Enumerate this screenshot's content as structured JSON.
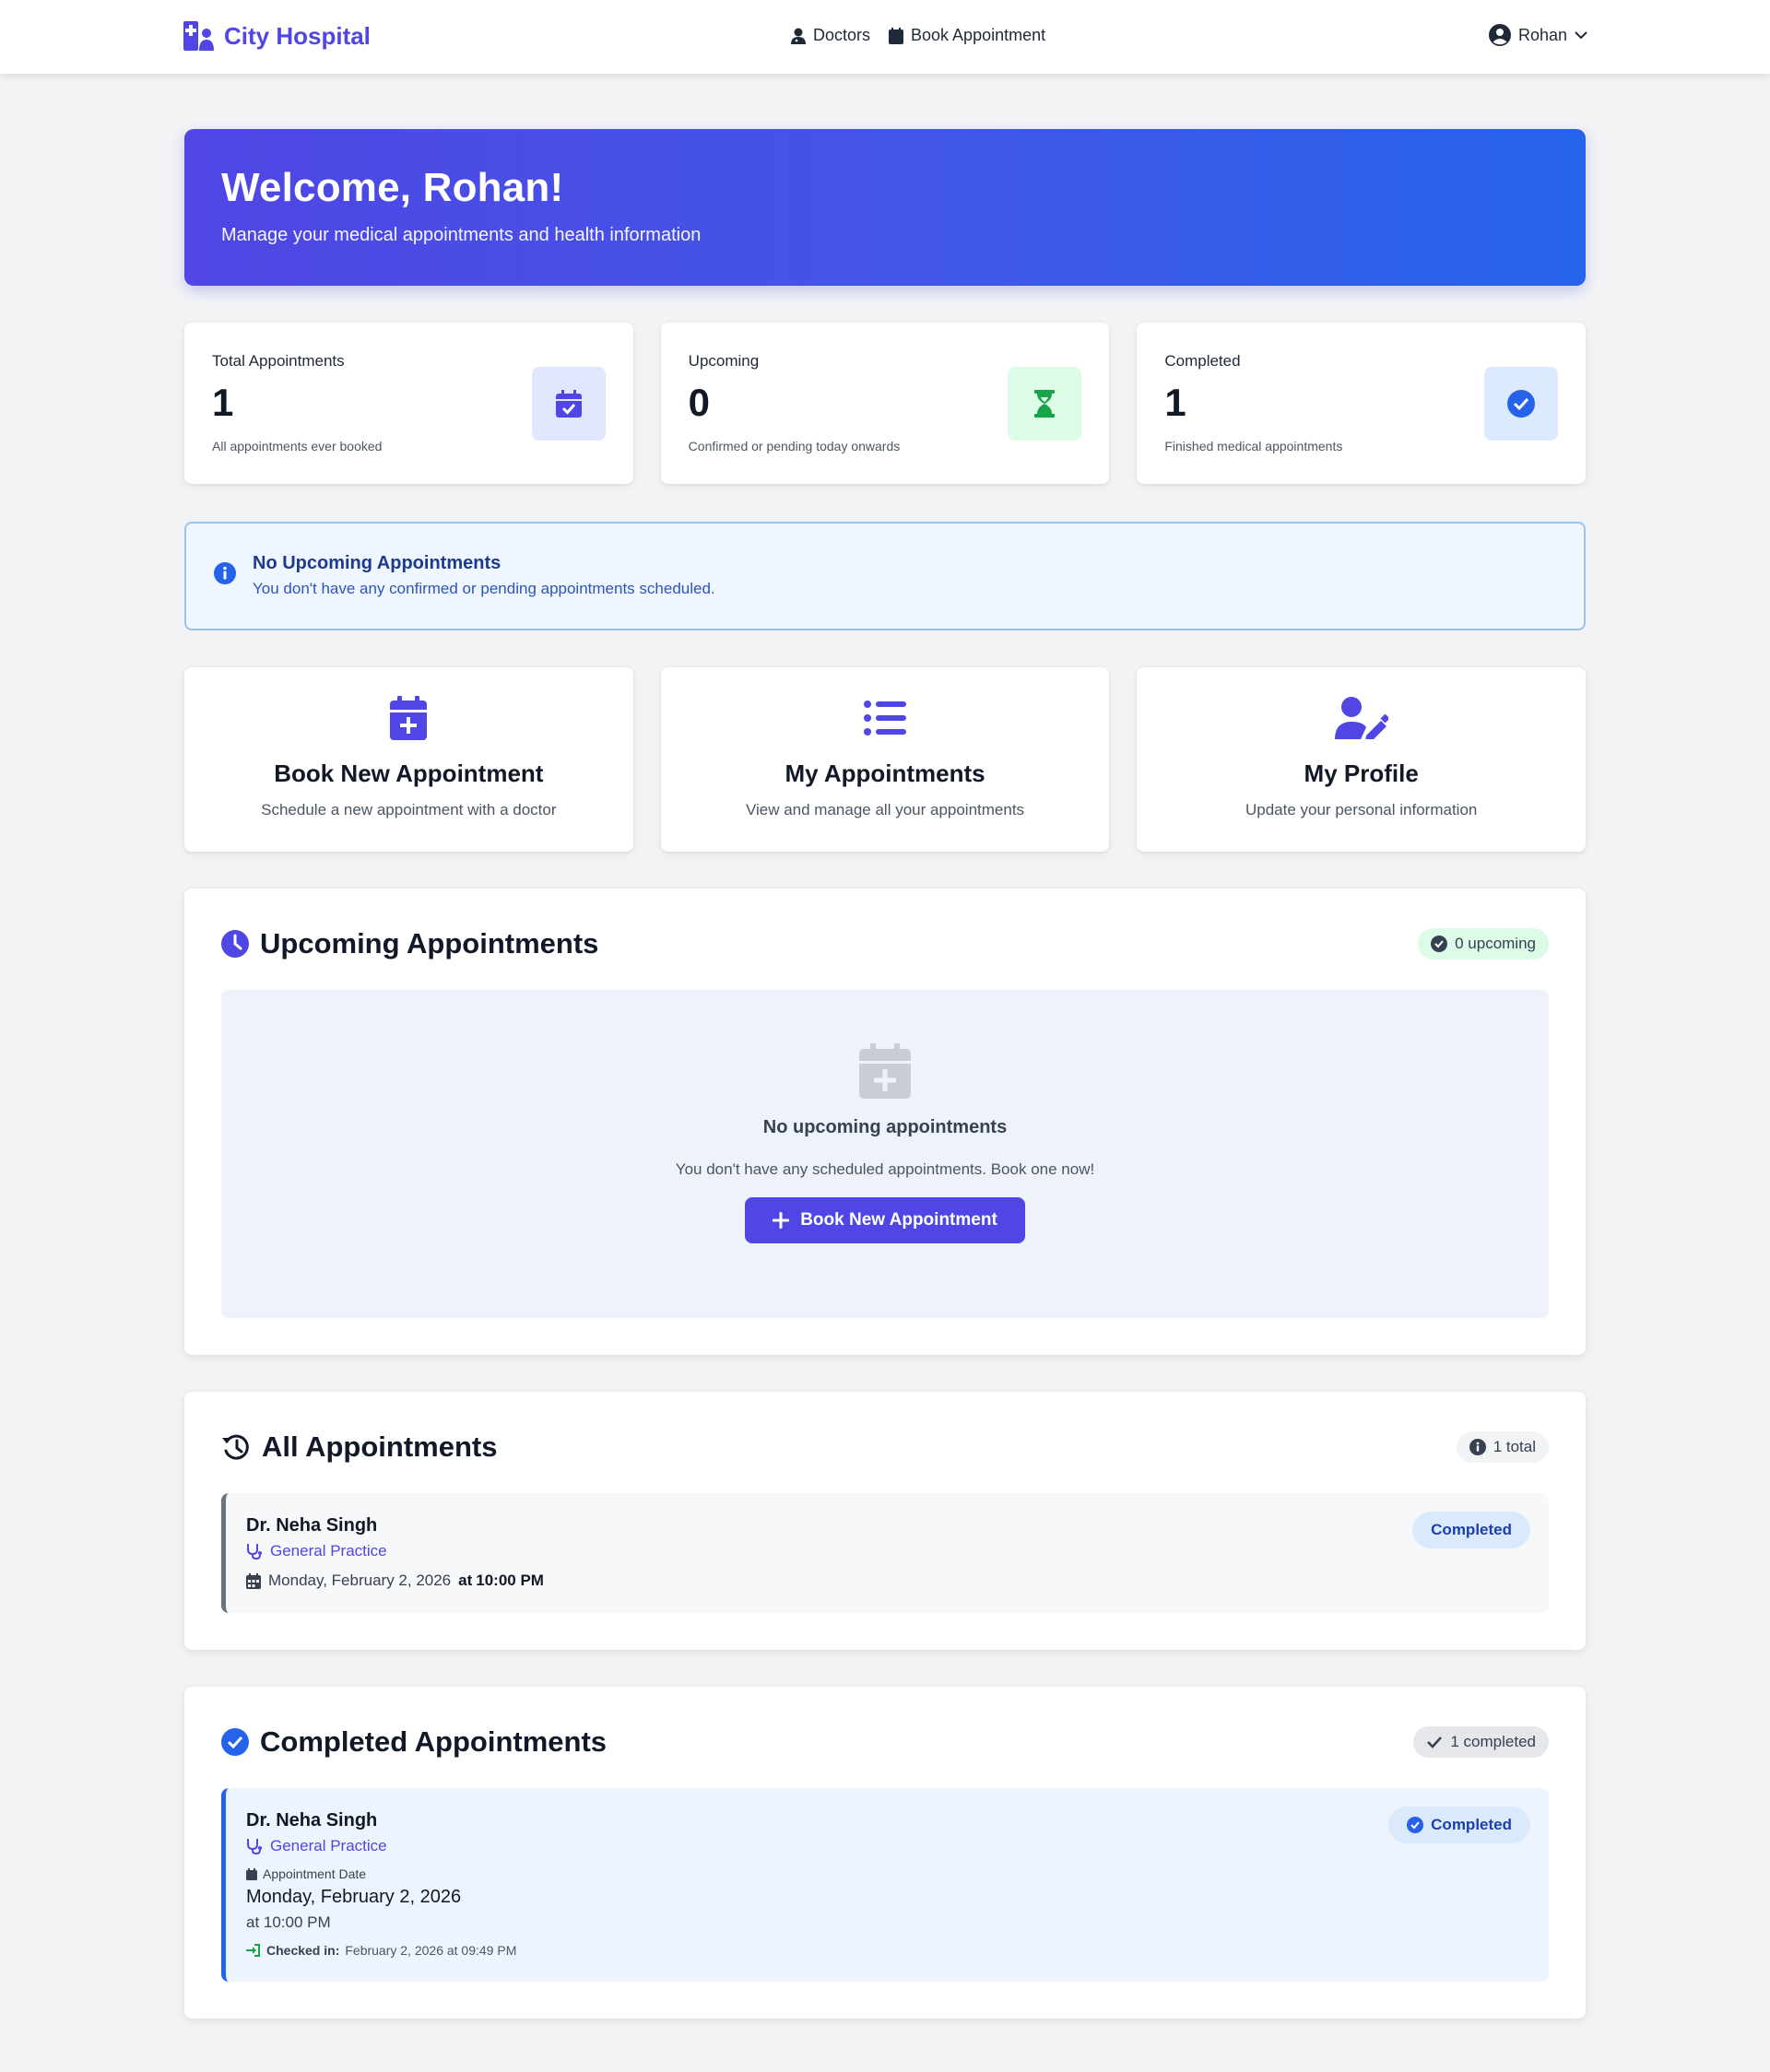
{
  "navbar": {
    "brand": "City Hospital",
    "links": [
      {
        "label": "Doctors",
        "icon": "user-md-icon"
      },
      {
        "label": "Book Appointment",
        "icon": "calendar-icon"
      }
    ],
    "user": "Rohan"
  },
  "hero": {
    "title": "Welcome, Rohan!",
    "subtitle": "Manage your medical appointments and health information"
  },
  "stats": [
    {
      "label": "Total Appointments",
      "value": "1",
      "desc": "All appointments ever booked",
      "icon": "calendar-check-icon",
      "color": "#4f46e5",
      "bg": "#e0e7ff"
    },
    {
      "label": "Upcoming",
      "value": "0",
      "desc": "Confirmed or pending today onwards",
      "icon": "hourglass-icon",
      "color": "#16a34a",
      "bg": "#dcfce7"
    },
    {
      "label": "Completed",
      "value": "1",
      "desc": "Finished medical appointments",
      "icon": "check-circle-icon",
      "color": "#2563eb",
      "bg": "#dbeafe"
    }
  ],
  "alert": {
    "title": "No Upcoming Appointments",
    "text": "You don't have any confirmed or pending appointments scheduled."
  },
  "actions": [
    {
      "title": "Book New Appointment",
      "desc": "Schedule a new appointment with a doctor",
      "icon": "calendar-plus-icon"
    },
    {
      "title": "My Appointments",
      "desc": "View and manage all your appointments",
      "icon": "list-icon"
    },
    {
      "title": "My Profile",
      "desc": "Update your personal information",
      "icon": "user-edit-icon"
    }
  ],
  "upcoming": {
    "title": "Upcoming Appointments",
    "badge": "0 upcoming",
    "empty_title": "No upcoming appointments",
    "empty_text": "You don't have any scheduled appointments. Book one now!",
    "button": "Book New Appointment"
  },
  "all": {
    "title": "All Appointments",
    "badge": "1 total",
    "items": [
      {
        "doctor": "Dr. Neha Singh",
        "specialty": "General Practice",
        "date": "Monday, February 2, 2026",
        "at": "at",
        "time": "10:00 PM",
        "status": "Completed"
      }
    ]
  },
  "completed": {
    "title": "Completed Appointments",
    "badge": "1 completed",
    "items": [
      {
        "doctor": "Dr. Neha Singh",
        "specialty": "General Practice",
        "date_label": "Appointment Date",
        "date": "Monday, February 2, 2026",
        "time": "at 10:00 PM",
        "checkin_label": "Checked in:",
        "checkin": "February 2, 2026 at 09:49 PM",
        "status": "Completed"
      }
    ]
  }
}
